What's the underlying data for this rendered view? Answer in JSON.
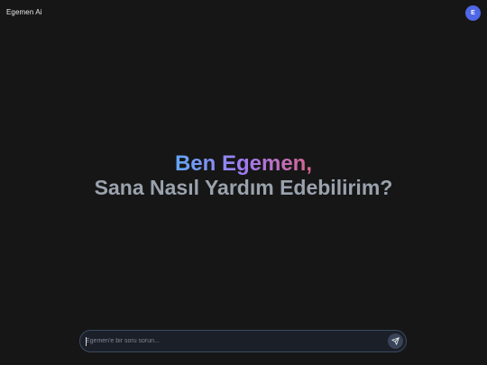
{
  "header": {
    "app_title": "Egemen Ai",
    "avatar_initial": "E"
  },
  "hero": {
    "greeting": "Ben Egemen,",
    "question": "Sana Nasıl Yardım Edebilirim?"
  },
  "composer": {
    "placeholder": "Egemen'e bir soru sorun...",
    "value": "",
    "send_icon": "send-icon"
  },
  "colors": {
    "background": "#161616",
    "avatar": "#4e67e6",
    "gradient_start": "#62a6f4",
    "gradient_mid": "#9f7cf3",
    "gradient_end": "#d7648d",
    "subtitle": "#9aa2ad",
    "composer_border": "#3b4a63"
  }
}
